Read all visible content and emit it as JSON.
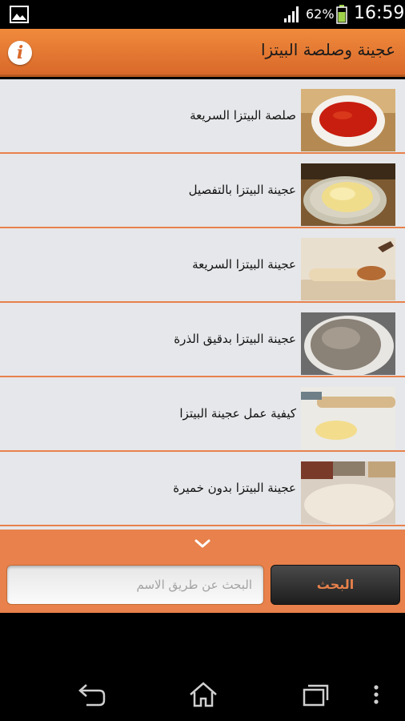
{
  "status_bar": {
    "battery_percent": "62%",
    "time": "16:59",
    "icons": [
      "gallery-icon",
      "signal-icon",
      "battery-icon"
    ]
  },
  "header": {
    "title": "عجينة وصلصة البيتزا",
    "info_icon": "info-icon",
    "info_glyph": "i"
  },
  "recipes": [
    {
      "label": "صلصة البيتزا السريعة",
      "thumb": "tomato-sauce-bowl"
    },
    {
      "label": "عجينة البيتزا بالتفصيل",
      "thumb": "dough-in-bowl"
    },
    {
      "label": "عجينة البيتزا السريعة",
      "thumb": "rolled-dough"
    },
    {
      "label": "عجينة البيتزا بدقيق الذرة",
      "thumb": "cornmeal-dough"
    },
    {
      "label": "كيفية عمل عجينة البيتزا",
      "thumb": "rolling-pin-dough"
    },
    {
      "label": "عجينة البيتزا بدون خميرة",
      "thumb": "flat-dough"
    }
  ],
  "search": {
    "placeholder": "البحث عن طريق الاسم",
    "button_label": "البحث"
  },
  "nav": [
    "back-icon",
    "home-icon",
    "recent-apps-icon",
    "menu-icon"
  ],
  "colors": {
    "accent": "#e8814b",
    "header_top": "#f08a3c",
    "header_bottom": "#d9692a",
    "list_bg": "#e6e7ea"
  }
}
